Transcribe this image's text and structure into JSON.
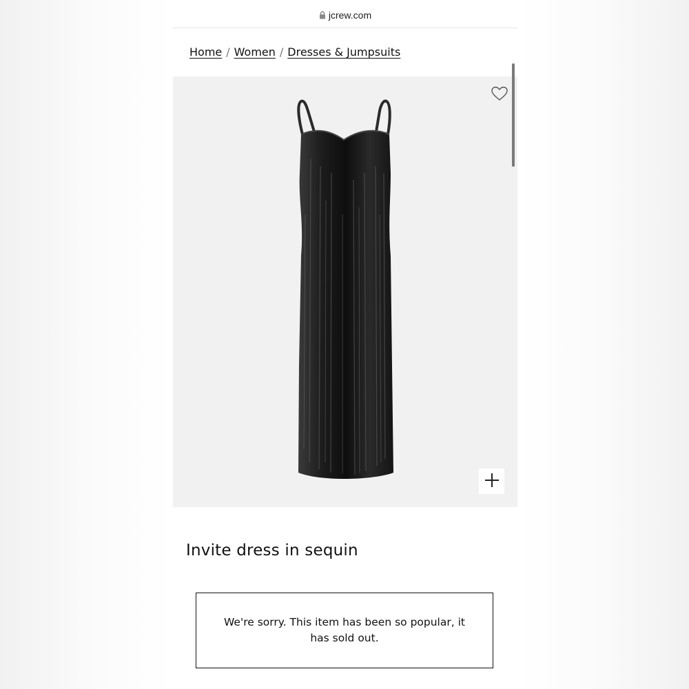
{
  "browser": {
    "url": "jcrew.com",
    "lock_icon": "lock-icon"
  },
  "breadcrumb": [
    {
      "label": "Home"
    },
    {
      "label": "Women"
    },
    {
      "label": "Dresses & Jumpsuits"
    }
  ],
  "breadcrumb_separator": "/",
  "product": {
    "title": "Invite dress in sequin",
    "image_icons": {
      "wishlist": "heart-icon",
      "zoom": "plus-icon"
    },
    "sold_out_message": "We're sorry. This item has been so popular, it has sold out."
  },
  "colors": {
    "image_background": "#f1f1f1",
    "dress": "#1a1a1a",
    "text": "#111111",
    "border": "#111111"
  }
}
